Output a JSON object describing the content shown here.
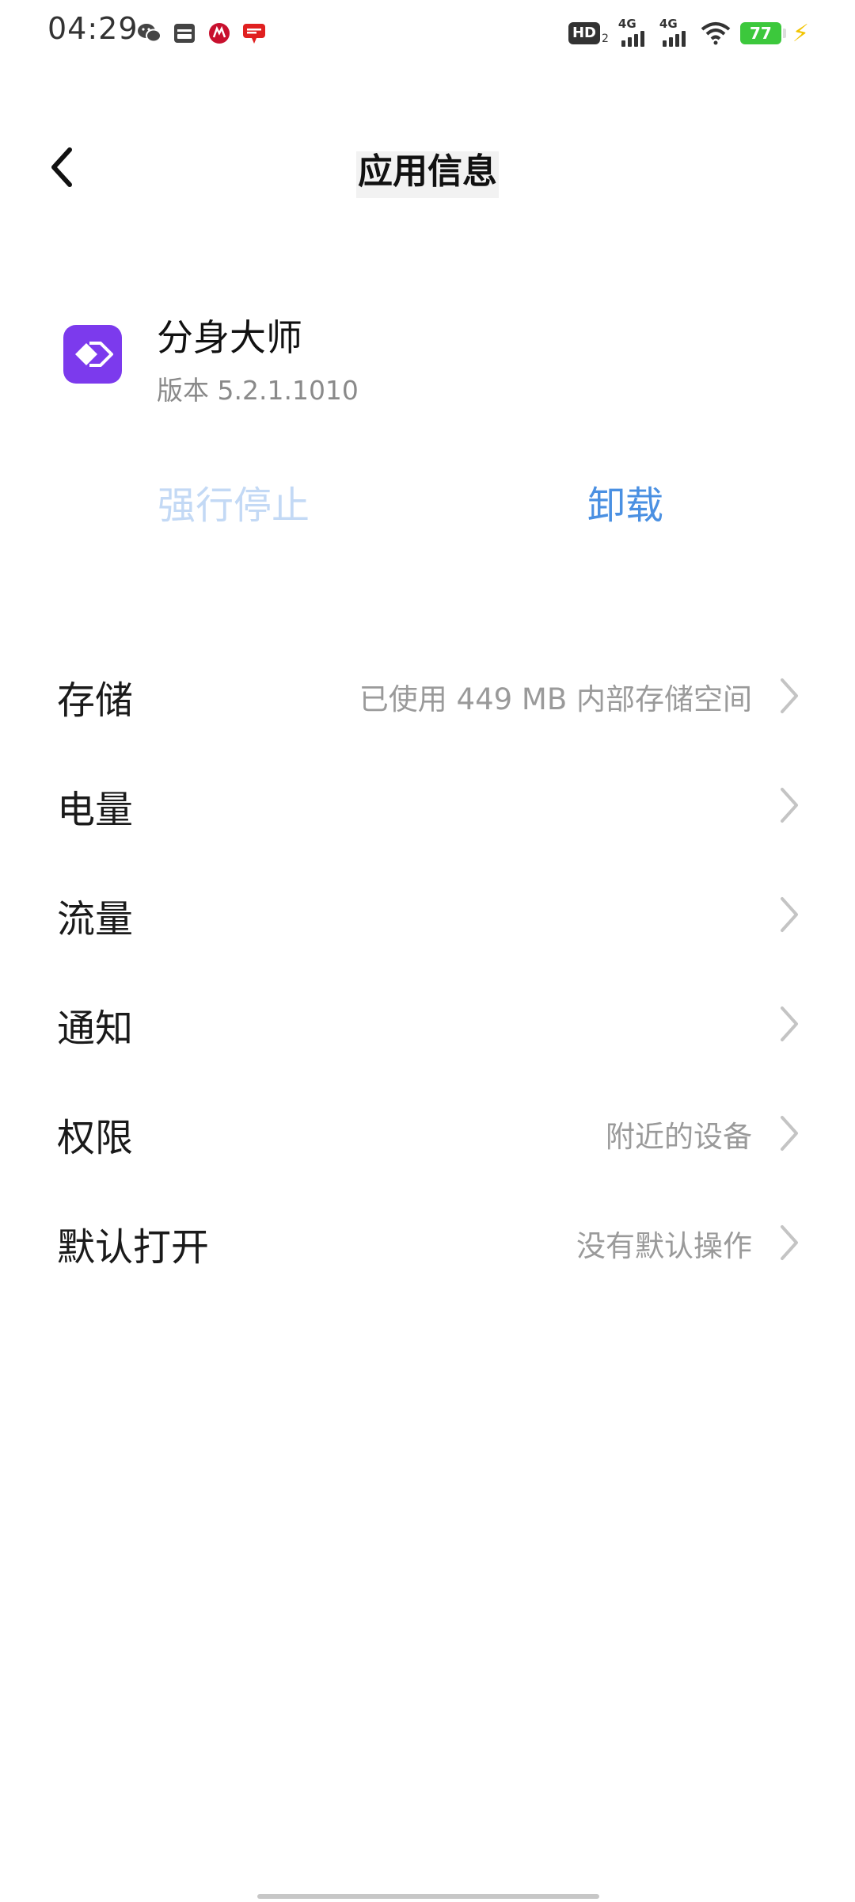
{
  "status_bar": {
    "time": "04:29",
    "left_icons": [
      "wechat-icon",
      "wallet-icon",
      "bank-icon",
      "message-icon"
    ],
    "hd_label": "HD",
    "hd_sub": "2",
    "signal_1_label": "4G",
    "signal_2_label": "4G",
    "battery_percent": "77",
    "charging": true
  },
  "header": {
    "title": "应用信息"
  },
  "app": {
    "name": "分身大师",
    "version": "版本 5.2.1.1010",
    "icon_color": "#7c3aed"
  },
  "actions": {
    "force_stop_label": "强行停止",
    "uninstall_label": "卸载",
    "force_stop_color": "#c3d9f5",
    "uninstall_color": "#4a90e2"
  },
  "settings": [
    {
      "label": "存储",
      "value": "已使用 449 MB 内部存储空间"
    },
    {
      "label": "电量",
      "value": ""
    },
    {
      "label": "流量",
      "value": ""
    },
    {
      "label": "通知",
      "value": ""
    },
    {
      "label": "权限",
      "value": "附近的设备"
    },
    {
      "label": "默认打开",
      "value": "没有默认操作"
    }
  ]
}
